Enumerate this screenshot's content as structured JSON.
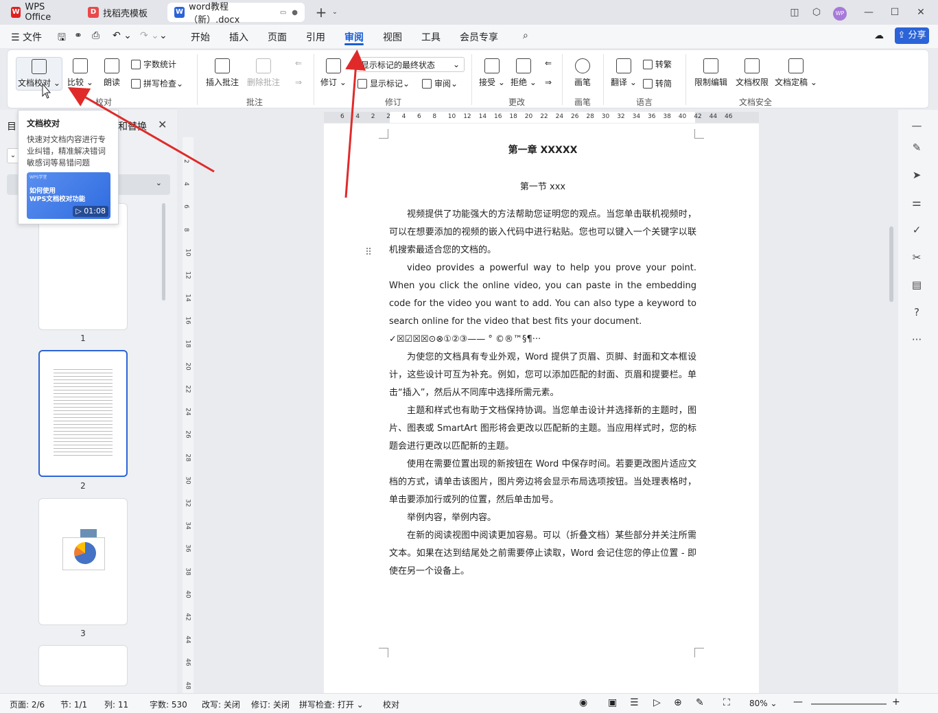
{
  "tabs": [
    {
      "label": "WPS Office",
      "icon": "wps-logo-icon",
      "color": "#e02020"
    },
    {
      "label": "找稻壳模板",
      "icon": "docer-icon",
      "color": "#e84a4a"
    },
    {
      "label": "word教程（新）.docx",
      "icon": "word-doc-icon",
      "color": "#2b63d8"
    }
  ],
  "menu": {
    "file": "文件",
    "items": [
      "开始",
      "插入",
      "页面",
      "引用",
      "审阅",
      "视图",
      "工具",
      "会员专享"
    ],
    "selected": "审阅",
    "share": "分享"
  },
  "ribbon": {
    "doc_check": "文档校对",
    "compare": "比较",
    "read_aloud": "朗读",
    "word_count": "字数统计",
    "spell_check": "拼写检查",
    "insert_comment": "插入批注",
    "delete_comment": "删除批注",
    "track_changes": "修订",
    "markup_state": "显示标记的最终状态",
    "show_markup": "显示标记",
    "review_pane": "审阅",
    "accept": "接受",
    "reject": "拒绝",
    "pen": "画笔",
    "translate": "翻译",
    "to_traditional": "转繁",
    "to_simplified": "转简",
    "restrict_edit": "限制编辑",
    "doc_permission": "文档权限",
    "doc_final": "文档定稿",
    "groups": [
      "校对",
      "批注",
      "修订",
      "更改",
      "画笔",
      "语言",
      "文档安全"
    ]
  },
  "popup": {
    "title": "文档校对",
    "desc": "快速对文档内容进行专业纠错，精准解决错词敏感词等易错问题",
    "video_brand": "WPS学堂",
    "video_title": "如何使用\nWPS文档校对功能",
    "video_time": "01:08"
  },
  "left_panel": {
    "title_partial": "目",
    "find_replace_partial": "和替换",
    "thumbs": [
      "1",
      "2",
      "3"
    ]
  },
  "ruler_h": [
    "6",
    "4",
    "2",
    "2",
    "4",
    "6",
    "8",
    "10",
    "12",
    "14",
    "16",
    "18",
    "20",
    "22",
    "24",
    "26",
    "28",
    "30",
    "32",
    "34",
    "36",
    "38",
    "40",
    "42",
    "44",
    "46"
  ],
  "ruler_v": [
    "2",
    "4",
    "6",
    "8",
    "10",
    "12",
    "14",
    "16",
    "18",
    "20",
    "22",
    "24",
    "26",
    "28",
    "30",
    "32",
    "34",
    "36",
    "38",
    "40",
    "42",
    "44",
    "46",
    "48"
  ],
  "document": {
    "chapter": "第一章  XXXXX",
    "section": "第一节  xxx",
    "paragraphs": [
      "视频提供了功能强大的方法帮助您证明您的观点。当您单击联机视频时，可以在想要添加的视频的嵌入代码中进行粘贴。您也可以键入一个关键字以联机搜索最适合您的文档的。",
      "video provides a powerful way to help you prove your point. When you click the online video, you can paste in the embedding code for the video you want to add. You can also type a keyword to search online for the video that best fits your document.",
      "为使您的文档具有专业外观，Word 提供了页眉、页脚、封面和文本框设计，这些设计可互为补充。例如，您可以添加匹配的封面、页眉和提要栏。单击“插入”，然后从不同库中选择所需元素。",
      "主题和样式也有助于文档保持协调。当您单击设计并选择新的主题时，图片、图表或 SmartArt 图形将会更改以匹配新的主题。当应用样式时，您的标题会进行更改以匹配新的主题。",
      "使用在需要位置出现的新按钮在 Word 中保存时间。若要更改图片适应文档的方式，请单击该图片，图片旁边将会显示布局选项按钮。当处理表格时，单击要添加行或列的位置，然后单击加号。",
      "举例内容，举例内容。",
      "在新的阅读视图中阅读更加容易。可以（折叠文档）某些部分并关注所需文本。如果在达到结尾处之前需要停止读取，Word 会记住您的停止位置 - 即使在另一个设备上。"
    ],
    "symbols_line": "✓☒☑☒☒⊙⊗①②③——  °  ©®™§¶···"
  },
  "status": {
    "page": "页面: 2/6",
    "section": "节: 1/1",
    "column": "列: 11",
    "word_count": "字数: 530",
    "overwrite": "改写: 关闭",
    "revision": "修订: 关闭",
    "spell": "拼写检查: 打开",
    "proof": "校对",
    "zoom": "80%"
  },
  "colors": {
    "accent": "#2b63d8",
    "arrow": "#e02a2a"
  }
}
